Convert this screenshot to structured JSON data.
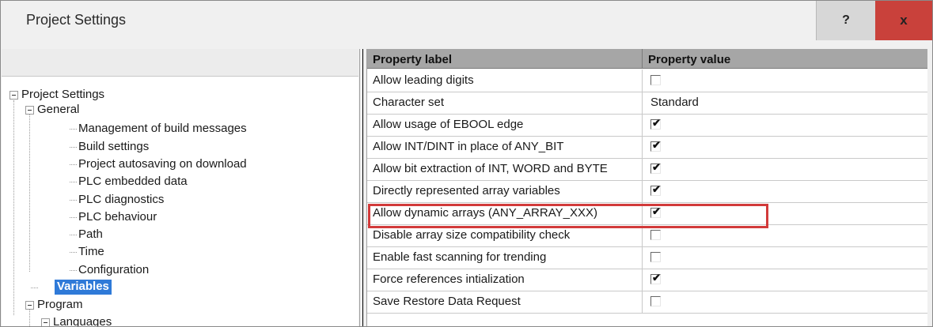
{
  "window": {
    "title": "Project Settings",
    "help_label": "?",
    "close_label": "x"
  },
  "tree": {
    "root": "Project Settings",
    "general": "General",
    "items": [
      "Management of build messages",
      "Build settings",
      "Project autosaving on download",
      "PLC embedded data",
      "PLC diagnostics",
      "PLC behaviour",
      "Path",
      "Time",
      "Configuration"
    ],
    "selected": "Variables",
    "program": "Program",
    "languages": "Languages"
  },
  "grid": {
    "headers": [
      "Property label",
      "Property value"
    ],
    "rows": [
      {
        "label": "Allow leading digits",
        "type": "checkbox",
        "checked": false
      },
      {
        "label": "Character set",
        "type": "text",
        "value": "Standard"
      },
      {
        "label": "Allow usage of EBOOL edge",
        "type": "checkbox",
        "checked": true
      },
      {
        "label": "Allow INT/DINT in place of ANY_BIT",
        "type": "checkbox",
        "checked": true
      },
      {
        "label": "Allow bit extraction of INT, WORD and BYTE",
        "type": "checkbox",
        "checked": true
      },
      {
        "label": "Directly represented array variables",
        "type": "checkbox",
        "checked": true
      },
      {
        "label": "Allow dynamic arrays (ANY_ARRAY_XXX)",
        "type": "checkbox",
        "checked": true
      },
      {
        "label": "Disable array size compatibility check",
        "type": "checkbox",
        "checked": false
      },
      {
        "label": "Enable fast scanning for trending",
        "type": "checkbox",
        "checked": false
      },
      {
        "label": "Force references intialization",
        "type": "checkbox",
        "checked": true
      },
      {
        "label": "Save Restore Data Request",
        "type": "checkbox",
        "checked": false
      }
    ],
    "highlighted_row": "Allow dynamic arrays (ANY_ARRAY_XXX)",
    "highlight_color": "#d23a3a",
    "selection_color": "#2f7ad8",
    "close_button_color": "#c9413b"
  }
}
